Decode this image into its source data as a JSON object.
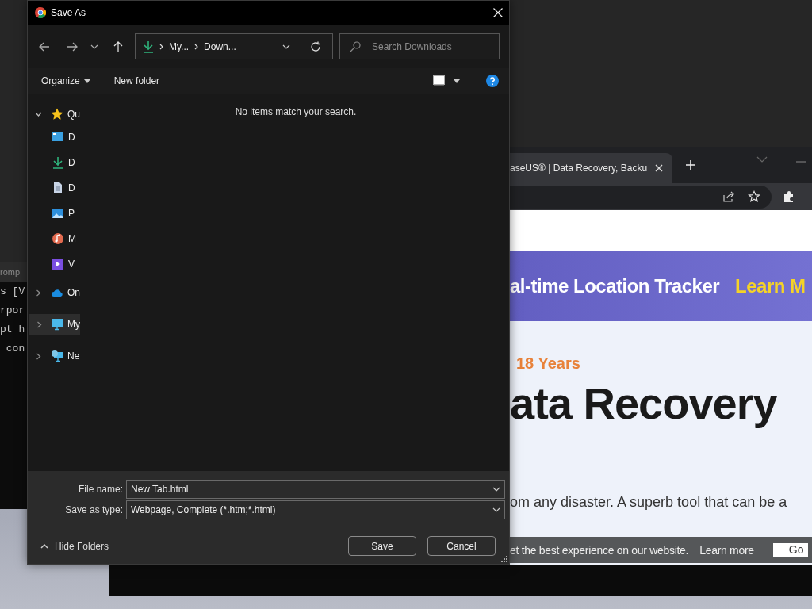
{
  "terminal": {
    "title": "romp",
    "lines": [
      "s [V",
      "rpor",
      "pt h",
      " con"
    ]
  },
  "browser": {
    "tabs": [
      {
        "title": "aseUS® | Data Recovery, Backu",
        "selected": true
      }
    ],
    "page": {
      "banner": {
        "text": "al-time Location Tracker",
        "link": "Learn M"
      },
      "tagline": "18 Years",
      "heading": "ata Recovery",
      "body": "om any disaster. A superb tool that can be a",
      "cookie_bar": {
        "text": "et the best experience on our website.",
        "link": "Learn more",
        "button": "Go"
      }
    }
  },
  "dialog": {
    "title": "Save As",
    "address": {
      "segments": [
        "My...",
        "Down..."
      ]
    },
    "search": {
      "placeholder": "Search Downloads"
    },
    "commands": [
      "Organize",
      "New folder"
    ],
    "nav": [
      {
        "label": "Qu",
        "kind": "star",
        "expanded": true,
        "selected": false,
        "children": [
          {
            "label": "D",
            "kind": "desktop",
            "selected": false
          },
          {
            "label": "D",
            "kind": "download",
            "selected": false
          },
          {
            "label": "D",
            "kind": "document",
            "selected": false
          },
          {
            "label": "P",
            "kind": "picture",
            "selected": false
          },
          {
            "label": "M",
            "kind": "music",
            "selected": false
          },
          {
            "label": "V",
            "kind": "video",
            "selected": false
          }
        ]
      },
      {
        "label": "On",
        "kind": "cloud",
        "expanded": false,
        "selected": false
      },
      {
        "label": "My",
        "kind": "pc",
        "expanded": false,
        "selected": true
      },
      {
        "label": "Ne",
        "kind": "network",
        "expanded": false,
        "selected": false
      }
    ],
    "empty_message": "No items match your search.",
    "file_name": {
      "label": "File name:",
      "value": "New Tab.html"
    },
    "save_type": {
      "label": "Save as type:",
      "value": "Webpage, Complete (*.htm;*.html)"
    },
    "hide_folders": "Hide Folders",
    "buttons": [
      "Save",
      "Cancel"
    ]
  }
}
